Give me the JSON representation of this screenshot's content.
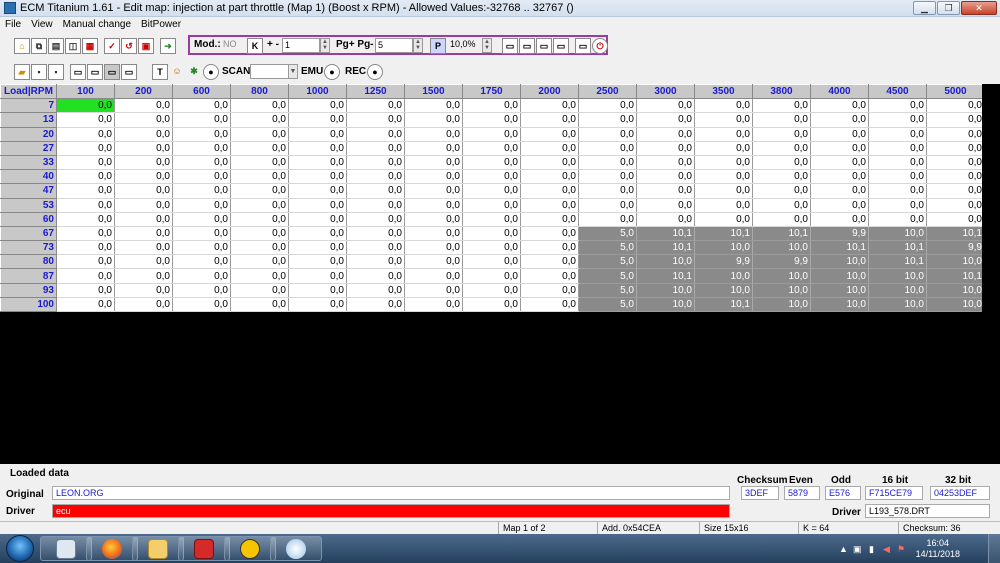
{
  "window": {
    "title": "ECM Titanium 1.61 - Edit map: injection at part throttle (Map 1) (Boost x RPM) - Allowed Values:-32768 .. 32767 ()"
  },
  "menu": [
    "File",
    "View",
    "Manual change",
    "BitPower"
  ],
  "toolbar": {
    "mod_label": "Mod.:",
    "mod_value": "NO",
    "step_label": "+ -",
    "step_value": "1",
    "pg_label": "Pg+ Pg-",
    "pg_value": "5",
    "percent_value": "10,0%",
    "scan_label": "SCAN",
    "emu_label": "EMU",
    "rec_label": "REC"
  },
  "grid": {
    "corner": "Load|RPM",
    "columns": [
      "100",
      "200",
      "600",
      "800",
      "1000",
      "1250",
      "1500",
      "1750",
      "2000",
      "2500",
      "3000",
      "3500",
      "3800",
      "4000",
      "4500",
      "5000"
    ],
    "rows": [
      {
        "load": "7",
        "values": [
          "0,0",
          "0,0",
          "0,0",
          "0,0",
          "0,0",
          "0,0",
          "0,0",
          "0,0",
          "0,0",
          "0,0",
          "0,0",
          "0,0",
          "0,0",
          "0,0",
          "0,0",
          "0,0"
        ]
      },
      {
        "load": "13",
        "values": [
          "0,0",
          "0,0",
          "0,0",
          "0,0",
          "0,0",
          "0,0",
          "0,0",
          "0,0",
          "0,0",
          "0,0",
          "0,0",
          "0,0",
          "0,0",
          "0,0",
          "0,0",
          "0,0"
        ]
      },
      {
        "load": "20",
        "values": [
          "0,0",
          "0,0",
          "0,0",
          "0,0",
          "0,0",
          "0,0",
          "0,0",
          "0,0",
          "0,0",
          "0,0",
          "0,0",
          "0,0",
          "0,0",
          "0,0",
          "0,0",
          "0,0"
        ]
      },
      {
        "load": "27",
        "values": [
          "0,0",
          "0,0",
          "0,0",
          "0,0",
          "0,0",
          "0,0",
          "0,0",
          "0,0",
          "0,0",
          "0,0",
          "0,0",
          "0,0",
          "0,0",
          "0,0",
          "0,0",
          "0,0"
        ]
      },
      {
        "load": "33",
        "values": [
          "0,0",
          "0,0",
          "0,0",
          "0,0",
          "0,0",
          "0,0",
          "0,0",
          "0,0",
          "0,0",
          "0,0",
          "0,0",
          "0,0",
          "0,0",
          "0,0",
          "0,0",
          "0,0"
        ]
      },
      {
        "load": "40",
        "values": [
          "0,0",
          "0,0",
          "0,0",
          "0,0",
          "0,0",
          "0,0",
          "0,0",
          "0,0",
          "0,0",
          "0,0",
          "0,0",
          "0,0",
          "0,0",
          "0,0",
          "0,0",
          "0,0"
        ]
      },
      {
        "load": "47",
        "values": [
          "0,0",
          "0,0",
          "0,0",
          "0,0",
          "0,0",
          "0,0",
          "0,0",
          "0,0",
          "0,0",
          "0,0",
          "0,0",
          "0,0",
          "0,0",
          "0,0",
          "0,0",
          "0,0"
        ]
      },
      {
        "load": "53",
        "values": [
          "0,0",
          "0,0",
          "0,0",
          "0,0",
          "0,0",
          "0,0",
          "0,0",
          "0,0",
          "0,0",
          "0,0",
          "0,0",
          "0,0",
          "0,0",
          "0,0",
          "0,0",
          "0,0"
        ]
      },
      {
        "load": "60",
        "values": [
          "0,0",
          "0,0",
          "0,0",
          "0,0",
          "0,0",
          "0,0",
          "0,0",
          "0,0",
          "0,0",
          "0,0",
          "0,0",
          "0,0",
          "0,0",
          "0,0",
          "0,0",
          "0,0"
        ]
      },
      {
        "load": "67",
        "values": [
          "0,0",
          "0,0",
          "0,0",
          "0,0",
          "0,0",
          "0,0",
          "0,0",
          "0,0",
          "0,0",
          "5,0",
          "10,1",
          "10,1",
          "10,1",
          "9,9",
          "10,0",
          "10,1"
        ]
      },
      {
        "load": "73",
        "values": [
          "0,0",
          "0,0",
          "0,0",
          "0,0",
          "0,0",
          "0,0",
          "0,0",
          "0,0",
          "0,0",
          "5,0",
          "10,1",
          "10,0",
          "10,0",
          "10,1",
          "10,1",
          "9,9"
        ]
      },
      {
        "load": "80",
        "values": [
          "0,0",
          "0,0",
          "0,0",
          "0,0",
          "0,0",
          "0,0",
          "0,0",
          "0,0",
          "0,0",
          "5,0",
          "10,0",
          "9,9",
          "9,9",
          "10,0",
          "10,1",
          "10,0"
        ]
      },
      {
        "load": "87",
        "values": [
          "0,0",
          "0,0",
          "0,0",
          "0,0",
          "0,0",
          "0,0",
          "0,0",
          "0,0",
          "0,0",
          "5,0",
          "10,1",
          "10,0",
          "10,0",
          "10,0",
          "10,0",
          "10,1"
        ]
      },
      {
        "load": "93",
        "values": [
          "0,0",
          "0,0",
          "0,0",
          "0,0",
          "0,0",
          "0,0",
          "0,0",
          "0,0",
          "0,0",
          "5,0",
          "10,0",
          "10,0",
          "10,0",
          "10,0",
          "10,0",
          "10,0"
        ]
      },
      {
        "load": "100",
        "values": [
          "0,0",
          "0,0",
          "0,0",
          "0,0",
          "0,0",
          "0,0",
          "0,0",
          "0,0",
          "0,0",
          "5,0",
          "10,0",
          "10,1",
          "10,0",
          "10,0",
          "10,0",
          "10,0"
        ]
      }
    ]
  },
  "info": {
    "loaded_data_label": "Loaded data",
    "original_label": "Original",
    "original_value": "LEON.ORG",
    "driver_label": "Driver",
    "driver_value": "ecu",
    "checksum_header": "Checksum",
    "even_header": "Even",
    "odd_header": "Odd",
    "bit16_header": "16 bit",
    "bit32_header": "32 bit",
    "checksum_value": "3DEF",
    "even_value": "5879",
    "odd_value": "E576",
    "bit16_value": "F715CE79",
    "bit32_value": "04253DEF",
    "driver_file_label": "Driver",
    "driver_file_value": "L193_578.DRT"
  },
  "status": {
    "map": "Map 1 of 2",
    "address": "Add. 0x54CEA",
    "size": "Size 15x16",
    "k": "K = 64",
    "checksum": "Checksum: 36"
  },
  "taskbar": {
    "time": "16:04",
    "date": "14/11/2018"
  },
  "colors": {
    "selected_cell": "#22e022",
    "modified_cell": "#8a8a8a",
    "driver_bar": "#ff0000",
    "header_text": "#1a1ad0",
    "group_border": "#9b3aa0"
  }
}
